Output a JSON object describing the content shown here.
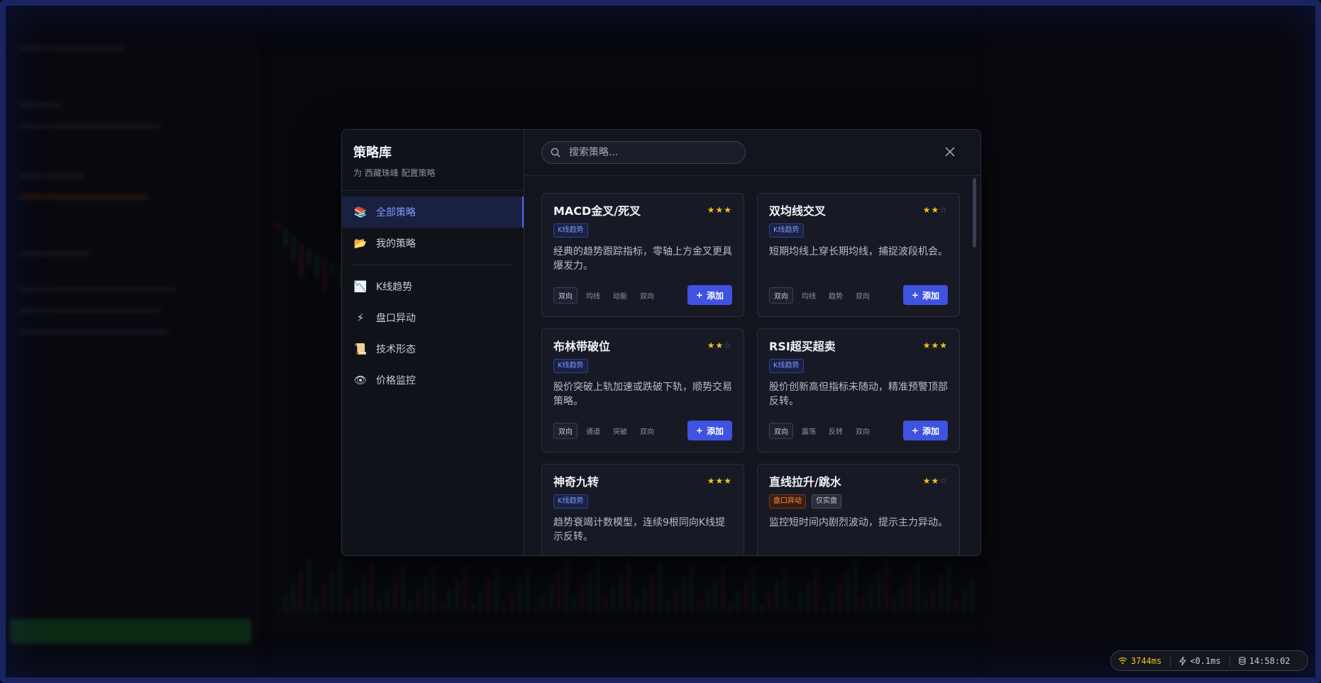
{
  "modal": {
    "title": "策略库",
    "subtitle": "为 西藏珠峰 配置策略",
    "search_placeholder": "搜索策略...",
    "nav": [
      {
        "icon": "books-icon",
        "glyph": "📚",
        "label": "全部策略",
        "active": true
      },
      {
        "icon": "folder-icon",
        "glyph": "📂",
        "label": "我的策略",
        "active": false
      },
      {
        "icon": "chart-down-icon",
        "glyph": "📉",
        "label": "K线趋势",
        "active": false
      },
      {
        "icon": "lightning-icon",
        "glyph": "⚡",
        "label": "盘口异动",
        "active": false
      },
      {
        "icon": "scroll-icon",
        "glyph": "📜",
        "label": "技术形态",
        "active": false
      },
      {
        "icon": "eye-icon",
        "glyph": "👁",
        "label": "价格监控",
        "active": false
      }
    ],
    "add_label": "添加",
    "cards": [
      {
        "title": "MACD金叉/死叉",
        "stars": 3,
        "badges": [
          {
            "text": "K线趋势",
            "style": "blue"
          }
        ],
        "desc": "经典的趋势跟踪指标，零轴上方金叉更具爆发力。",
        "tags": [
          "双向",
          "均线",
          "动能",
          "双向"
        ]
      },
      {
        "title": "双均线交叉",
        "stars": 2,
        "badges": [
          {
            "text": "K线趋势",
            "style": "blue"
          }
        ],
        "desc": "短期均线上穿长期均线，捕捉波段机会。",
        "tags": [
          "双向",
          "均线",
          "趋势",
          "双向"
        ]
      },
      {
        "title": "布林带破位",
        "stars": 2,
        "badges": [
          {
            "text": "K线趋势",
            "style": "blue"
          }
        ],
        "desc": "股价突破上轨加速或跌破下轨，顺势交易策略。",
        "tags": [
          "双向",
          "通道",
          "突破",
          "双向"
        ]
      },
      {
        "title": "RSI超买超卖",
        "stars": 3,
        "badges": [
          {
            "text": "K线趋势",
            "style": "blue"
          }
        ],
        "desc": "股价创新高但指标未随动，精准预警顶部反转。",
        "tags": [
          "双向",
          "震荡",
          "反转",
          "双向"
        ]
      },
      {
        "title": "神奇九转",
        "stars": 3,
        "badges": [
          {
            "text": "K线趋势",
            "style": "blue"
          }
        ],
        "desc": "趋势衰竭计数模型，连续9根同向K线提示反转。",
        "tags": []
      },
      {
        "title": "直线拉升/跳水",
        "stars": 2,
        "badges": [
          {
            "text": "盘口异动",
            "style": "orange"
          },
          {
            "text": "仅实盘",
            "style": "gray"
          }
        ],
        "desc": "监控短时间内剧烈波动，提示主力异动。",
        "tags": []
      }
    ]
  },
  "status_bar": {
    "latency": "3744ms",
    "processing": "<0.1ms",
    "clock": "14:58:02"
  },
  "colors": {
    "accent": "#3f52e0",
    "star": "#f2c31c",
    "up": "#2ea043",
    "down": "#d6343f"
  }
}
